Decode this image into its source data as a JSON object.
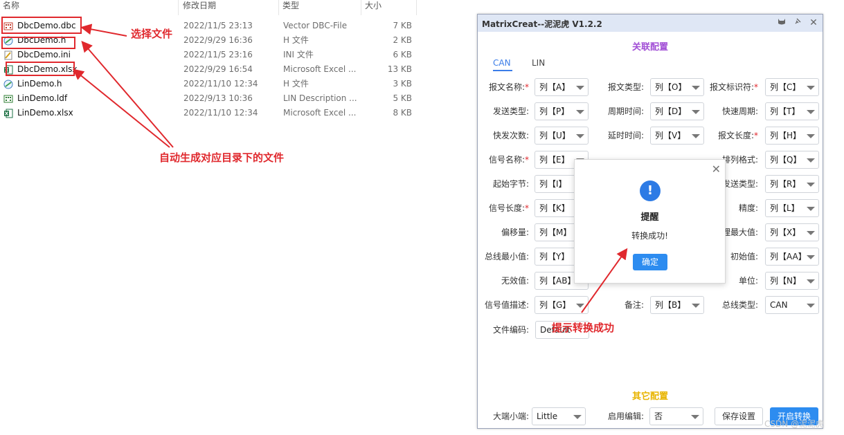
{
  "explorer": {
    "headers": {
      "name": "名称",
      "date": "修改日期",
      "type": "类型",
      "size": "大小"
    },
    "files": [
      {
        "icon": "dbc-file-icon",
        "name": "DbcDemo.dbc",
        "date": "2022/11/5 23:13",
        "type": "Vector DBC-File",
        "size": "7 KB"
      },
      {
        "icon": "c-header-file-icon",
        "name": "DbcDemo.h",
        "date": "2022/9/29 16:36",
        "type": "H 文件",
        "size": "2 KB"
      },
      {
        "icon": "ini-file-icon",
        "name": "DbcDemo.ini",
        "date": "2022/11/5 23:16",
        "type": "INI 文件",
        "size": "6 KB"
      },
      {
        "icon": "excel-file-icon",
        "name": "DbcDemo.xlsx",
        "date": "2022/9/29 16:54",
        "type": "Microsoft Excel ...",
        "size": "13 KB"
      },
      {
        "icon": "c-header-file-icon",
        "name": "LinDemo.h",
        "date": "2022/11/10 12:34",
        "type": "H 文件",
        "size": "3 KB"
      },
      {
        "icon": "ldf-file-icon",
        "name": "LinDemo.ldf",
        "date": "2022/9/13 10:36",
        "type": "LIN Description ...",
        "size": "5 KB"
      },
      {
        "icon": "excel-file-icon",
        "name": "LinDemo.xlsx",
        "date": "2022/11/10 12:34",
        "type": "Microsoft Excel ...",
        "size": "8 KB"
      }
    ]
  },
  "annotations": {
    "select_file": "选择文件",
    "auto_generate": "自动生成对应目录下的文件",
    "convert_success_hint": "提示转换成功",
    "color": "#e0282d"
  },
  "window": {
    "title": "MatrixCreat--泥泥虎 V1.2.2",
    "controls": [
      "cat-icon",
      "pin-icon",
      "close-icon"
    ],
    "section_main": "关联配置",
    "section_main_color": "#a24fd6",
    "tabs": [
      {
        "label": "CAN",
        "active": true
      },
      {
        "label": "LIN",
        "active": false
      }
    ],
    "fields": [
      {
        "label": "报文名称:",
        "required": true,
        "value": "列【A】"
      },
      {
        "label": "报文类型:",
        "required": false,
        "value": "列【O】"
      },
      {
        "label": "报文标识符:",
        "required": true,
        "value": "列【C】"
      },
      {
        "label": "发送类型:",
        "required": false,
        "value": "列【P】"
      },
      {
        "label": "周期时间:",
        "required": false,
        "value": "列【D】"
      },
      {
        "label": "快速周期:",
        "required": false,
        "value": "列【T】"
      },
      {
        "label": "快发次数:",
        "required": false,
        "value": "列【U】"
      },
      {
        "label": "延时时间:",
        "required": false,
        "value": "列【V】"
      },
      {
        "label": "报文长度:",
        "required": true,
        "value": "列【H】"
      },
      {
        "label": "信号名称:",
        "required": true,
        "value": "列【E】"
      },
      {
        "label": "",
        "required": false,
        "value": ""
      },
      {
        "label": "排列格式:",
        "required": false,
        "value": "列【Q】"
      },
      {
        "label": "起始字节:",
        "required": false,
        "value": "列【I】"
      },
      {
        "label": "",
        "required": false,
        "value": ""
      },
      {
        "label": "发送类型:",
        "required": false,
        "value": "列【R】"
      },
      {
        "label": "信号长度:",
        "required": true,
        "value": "列【K】"
      },
      {
        "label": "",
        "required": false,
        "value": ""
      },
      {
        "label": "精度:",
        "required": false,
        "value": "列【L】"
      },
      {
        "label": "偏移量:",
        "required": false,
        "value": "列【M】"
      },
      {
        "label": "",
        "required": false,
        "value": ""
      },
      {
        "label": "理最大值:",
        "required": false,
        "value": "列【X】"
      },
      {
        "label": "总线最小值:",
        "required": false,
        "value": "列【Y】"
      },
      {
        "label": "",
        "required": false,
        "value": ""
      },
      {
        "label": "初始值:",
        "required": false,
        "value": "列【AA】"
      },
      {
        "label": "无效值:",
        "required": false,
        "value": "列【AB】"
      },
      {
        "label": "",
        "required": false,
        "value": ""
      },
      {
        "label": "单位:",
        "required": false,
        "value": "列【N】"
      },
      {
        "label": "信号值描述:",
        "required": false,
        "value": "列【G】"
      },
      {
        "label": "备注:",
        "required": false,
        "value": "列【B】"
      },
      {
        "label": "总线类型:",
        "required": false,
        "value": "CAN"
      }
    ],
    "encoding": {
      "label": "文件编码:",
      "value": "Default"
    },
    "section_other": "其它配置",
    "section_other_color": "#e8b400",
    "endian": {
      "label": "大端小端:",
      "value": "Little"
    },
    "enable_edit": {
      "label": "启用编辑:",
      "value": "否"
    },
    "save_button": "保存设置",
    "start_button": "开启转换"
  },
  "modal": {
    "icon": "info-icon",
    "icon_glyph": "!",
    "title": "提醒",
    "message": "转换成功!",
    "ok_label": "确定"
  },
  "watermark": "CSDN @泥泥虎"
}
